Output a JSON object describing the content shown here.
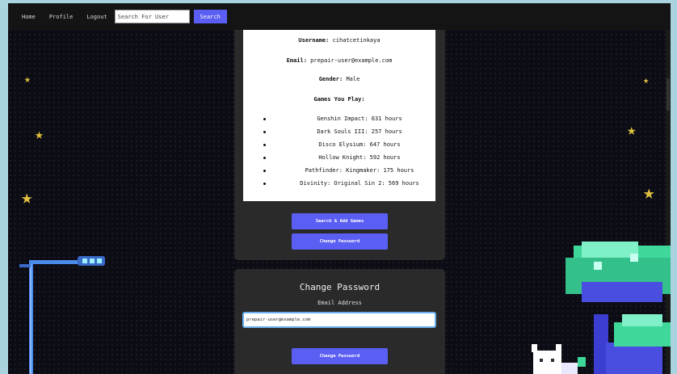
{
  "navbar": {
    "links": [
      "Home",
      "Profile",
      "Logout"
    ],
    "search_placeholder": "Search For User",
    "search_button": "Search"
  },
  "profile": {
    "username_label": "Username:",
    "username": "cihatcetinkaya",
    "email_label": "Email:",
    "email": "prepair-user@example.com",
    "gender_label": "Gender:",
    "gender": "Male",
    "games_heading": "Games You Play:",
    "games": [
      "Genshin Impact: 631 hours",
      "Dark Souls III: 257 hours",
      "Disco Elysium: 647 hours",
      "Hollow Knight: 592 hours",
      "Pathfinder: Kingmaker: 175 hours",
      "Divinity: Original Sin 2: 569 hours"
    ],
    "search_add_button": "Search & Add Games",
    "change_password_button": "Change Password"
  },
  "change_password": {
    "title": "Change Password",
    "email_label": "Email Address",
    "email_value": "prepair-user@example.com",
    "submit_button": "Change Password"
  },
  "colors": {
    "accent": "#5b5ef2",
    "background": "#0c0c14",
    "card": "#2a2a2b",
    "frame": "#a9d4df"
  }
}
